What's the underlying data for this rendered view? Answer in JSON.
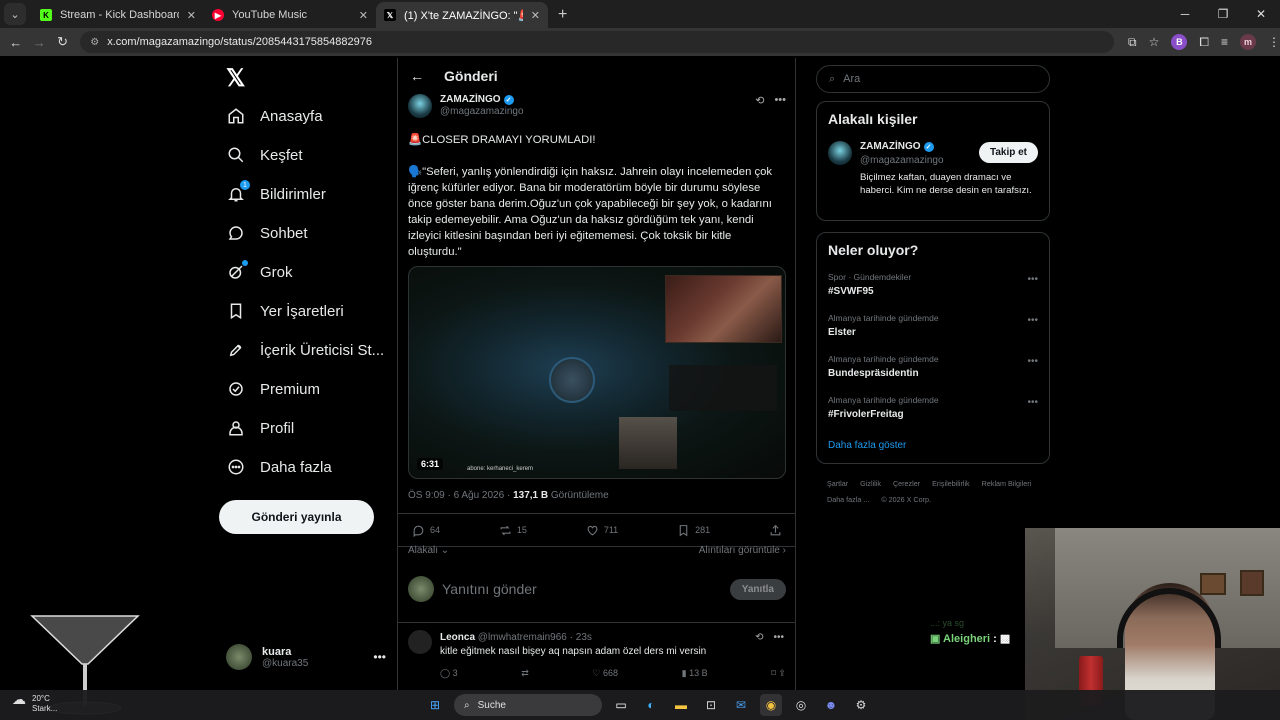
{
  "browser": {
    "tabs": [
      {
        "title": "Stream - Kick Dashboard",
        "favicon_color": "#53fc18",
        "favicon_letter": "K"
      },
      {
        "title": "YouTube Music",
        "favicon_color": "#ff0033",
        "favicon_letter": "▶"
      },
      {
        "title": "(1) X'te ZAMAZİNGO: \"🚨CLOSE",
        "favicon_color": "#000000",
        "favicon_letter": "𝕏"
      }
    ],
    "url": "x.com/magazamazingo/status/2085443175854882976",
    "profile_letter": "m"
  },
  "sidebar": {
    "logo": "𝕏",
    "items": [
      {
        "label": "Anasayfa",
        "icon": "home-icon"
      },
      {
        "label": "Keşfet",
        "icon": "search-icon"
      },
      {
        "label": "Bildirimler",
        "icon": "bell-icon",
        "badge": "1"
      },
      {
        "label": "Sohbet",
        "icon": "chat-icon"
      },
      {
        "label": "Grok",
        "icon": "grok-icon"
      },
      {
        "label": "Yer İşaretleri",
        "icon": "bookmark-icon"
      },
      {
        "label": "İçerik Üreticisi St...",
        "icon": "rocket-icon"
      },
      {
        "label": "Premium",
        "icon": "premium-icon"
      },
      {
        "label": "Profil",
        "icon": "person-icon"
      },
      {
        "label": "Daha fazla",
        "icon": "more-icon"
      }
    ],
    "post_button": "Gönderi yayınla",
    "account": {
      "name": "kuara",
      "handle": "@kuara35"
    }
  },
  "post": {
    "header": "Gönderi",
    "author": {
      "name": "ZAMAZİNGO",
      "handle": "@magazamazingo"
    },
    "headline": "🚨CLOSER DRAMAYI YORUMLADI!",
    "body": "🗣️\"Seferi, yanlış yönlendirdiği için haksız. Jahrein olayı incelemeden çok iğrenç küfürler ediyor. Bana bir moderatörüm böyle bir durumu söylese önce göster bana derim.Oğuz'un çok yapabileceği bir şey yok, o kadarını takip edemeyebilir. Ama Oğuz'un da haksız gördüğüm tek yanı, kendi izleyici kitlesini başından beri iyi eğitememesi. Çok toksik bir kitle oluşturdu.\"",
    "video_duration": "6:31",
    "video_caption": "abone: kerhaneci_kerem",
    "time": "ÖS 9:09 · 6 Ağu 2026 · ",
    "views": "137,1 B",
    "views_label": " Görüntüleme",
    "stats": {
      "replies": "64",
      "reposts": "15",
      "likes": "711",
      "bookmarks": "281"
    },
    "related_label": "Alakalı",
    "quotes_label": "Alıntıları görüntüle",
    "reply_placeholder": "Yanıtını gönder",
    "reply_button": "Yanıtla"
  },
  "comment": {
    "name": "Leonca",
    "meta": " @lmwhatremain966 · 23s",
    "text": "kitle eğitmek nasıl bişey aq napsın adam özel ders mi versin",
    "replies": "3",
    "likes": "668",
    "views": "13 B"
  },
  "right": {
    "search_placeholder": "Ara",
    "related_title": "Alakalı kişiler",
    "related_person": {
      "name": "ZAMAZİNGO",
      "handle": "@magazamazingo",
      "follow": "Takip et",
      "bio": "Biçilmez kaftan, duayen dramacı ve haberci. Kim ne derse desin en tarafsızı."
    },
    "trends_title": "Neler oluyor?",
    "trends": [
      {
        "context": "Spor · Gündemdekiler",
        "title": "#SVWF95"
      },
      {
        "context": "Almanya tarihinde gündemde",
        "title": "Elster"
      },
      {
        "context": "Almanya tarihinde gündemde",
        "title": "Bundespräsidentin"
      },
      {
        "context": "Almanya tarihinde gündemde",
        "title": "#FrivolerFreitag"
      }
    ],
    "show_more": "Daha fazla göster",
    "footer": [
      "Şartlar",
      "Gizlilik",
      "Çerezler",
      "Erişilebilirlik",
      "Reklam Bilgileri",
      "Daha fazla ...",
      "© 2026 X Corp."
    ]
  },
  "overlay": {
    "chat_line1": "...: ya sg",
    "chat_user": "Aleigheri",
    "chat_sep": " :"
  },
  "taskbar": {
    "temp": "20°C",
    "weather": "Stark...",
    "search": "Suche"
  }
}
